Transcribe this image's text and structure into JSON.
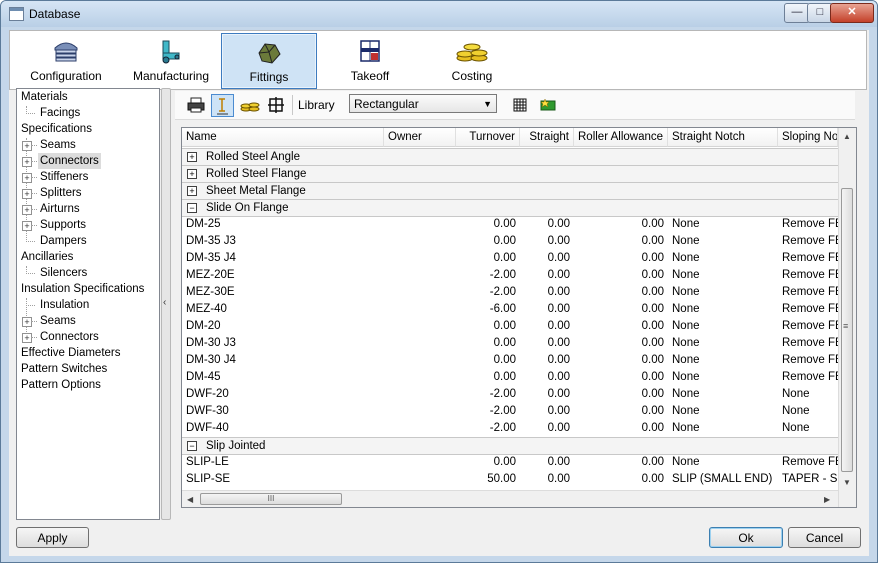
{
  "window": {
    "title": "Database",
    "controls": {
      "minimize": "—",
      "maximize": "□",
      "close": "✕"
    }
  },
  "tabs": [
    {
      "label": "Configuration",
      "icon": "configuration-icon",
      "active": false
    },
    {
      "label": "Manufacturing",
      "icon": "manufacturing-icon",
      "active": false
    },
    {
      "label": "Fittings",
      "icon": "fittings-icon",
      "active": true
    },
    {
      "label": "Takeoff",
      "icon": "takeoff-icon",
      "active": false
    },
    {
      "label": "Costing",
      "icon": "costing-icon",
      "active": false
    }
  ],
  "tree": {
    "materials": "Materials",
    "facings": "Facings",
    "specifications": "Specifications",
    "seams": "Seams",
    "connectors": "Connectors",
    "stiffeners": "Stiffeners",
    "splitters": "Splitters",
    "airturns": "Airturns",
    "supports": "Supports",
    "dampers": "Dampers",
    "ancillaries": "Ancillaries",
    "silencers": "Silencers",
    "insulation_specifications": "Insulation Specifications",
    "insulation": "Insulation",
    "ins_seams": "Seams",
    "ins_connectors": "Connectors",
    "effective_diameters": "Effective Diameters",
    "pattern_switches": "Pattern Switches",
    "pattern_options": "Pattern Options",
    "selected": "Connectors"
  },
  "splitter": {
    "glyph": "‹"
  },
  "toolbar": {
    "library_label": "Library",
    "library_value": "Rectangular",
    "icons": [
      "print-icon",
      "text-icon",
      "coins-icon",
      "grid-crosshair-icon",
      "table-icon",
      "add-icon"
    ]
  },
  "columns": [
    "Name",
    "Owner",
    "Turnover",
    "Straight",
    "Roller Allowance",
    "Straight Notch",
    "Sloping Notch"
  ],
  "groups": [
    {
      "label": "Rolled Steel Angle",
      "expanded": false,
      "rows": []
    },
    {
      "label": "Rolled Steel Flange",
      "expanded": false,
      "rows": []
    },
    {
      "label": "Sheet Metal Flange",
      "expanded": false,
      "rows": []
    },
    {
      "label": "Slide On Flange",
      "expanded": true,
      "rows": [
        {
          "name": "DM-25",
          "owner": "",
          "turnover": "0.00",
          "straight": "0.00",
          "roller": "0.00",
          "straight_notch": "None",
          "sloping_notch": "Remove FE"
        },
        {
          "name": "DM-35 J3",
          "owner": "",
          "turnover": "0.00",
          "straight": "0.00",
          "roller": "0.00",
          "straight_notch": "None",
          "sloping_notch": "Remove FE"
        },
        {
          "name": "DM-35 J4",
          "owner": "",
          "turnover": "0.00",
          "straight": "0.00",
          "roller": "0.00",
          "straight_notch": "None",
          "sloping_notch": "Remove FE"
        },
        {
          "name": "MEZ-20E",
          "owner": "",
          "turnover": "-2.00",
          "straight": "0.00",
          "roller": "0.00",
          "straight_notch": "None",
          "sloping_notch": "Remove FE"
        },
        {
          "name": "MEZ-30E",
          "owner": "",
          "turnover": "-2.00",
          "straight": "0.00",
          "roller": "0.00",
          "straight_notch": "None",
          "sloping_notch": "Remove FE"
        },
        {
          "name": "MEZ-40",
          "owner": "",
          "turnover": "-6.00",
          "straight": "0.00",
          "roller": "0.00",
          "straight_notch": "None",
          "sloping_notch": "Remove FE"
        },
        {
          "name": "DM-20",
          "owner": "",
          "turnover": "0.00",
          "straight": "0.00",
          "roller": "0.00",
          "straight_notch": "None",
          "sloping_notch": "Remove FE"
        },
        {
          "name": "DM-30 J3",
          "owner": "",
          "turnover": "0.00",
          "straight": "0.00",
          "roller": "0.00",
          "straight_notch": "None",
          "sloping_notch": "Remove FE"
        },
        {
          "name": "DM-30 J4",
          "owner": "",
          "turnover": "0.00",
          "straight": "0.00",
          "roller": "0.00",
          "straight_notch": "None",
          "sloping_notch": "Remove FE"
        },
        {
          "name": "DM-45",
          "owner": "",
          "turnover": "0.00",
          "straight": "0.00",
          "roller": "0.00",
          "straight_notch": "None",
          "sloping_notch": "Remove FE"
        },
        {
          "name": "DWF-20",
          "owner": "",
          "turnover": "-2.00",
          "straight": "0.00",
          "roller": "0.00",
          "straight_notch": "None",
          "sloping_notch": "None"
        },
        {
          "name": "DWF-30",
          "owner": "",
          "turnover": "-2.00",
          "straight": "0.00",
          "roller": "0.00",
          "straight_notch": "None",
          "sloping_notch": "None"
        },
        {
          "name": "DWF-40",
          "owner": "",
          "turnover": "-2.00",
          "straight": "0.00",
          "roller": "0.00",
          "straight_notch": "None",
          "sloping_notch": "None"
        }
      ]
    },
    {
      "label": "Slip Jointed",
      "expanded": true,
      "rows": [
        {
          "name": "SLIP-LE",
          "owner": "",
          "turnover": "0.00",
          "straight": "0.00",
          "roller": "0.00",
          "straight_notch": "None",
          "sloping_notch": "Remove FE"
        },
        {
          "name": "SLIP-SE",
          "owner": "",
          "turnover": "50.00",
          "straight": "0.00",
          "roller": "0.00",
          "straight_notch": "SLIP (SMALL END)",
          "sloping_notch": "TAPER - SL"
        }
      ]
    }
  ],
  "scroll": {
    "up": "▲",
    "down": "▼",
    "left": "◀",
    "right": "▶",
    "grip_v": "≡",
    "grip_h": "III"
  },
  "buttons": {
    "apply": "Apply",
    "ok": "Ok",
    "cancel": "Cancel"
  }
}
